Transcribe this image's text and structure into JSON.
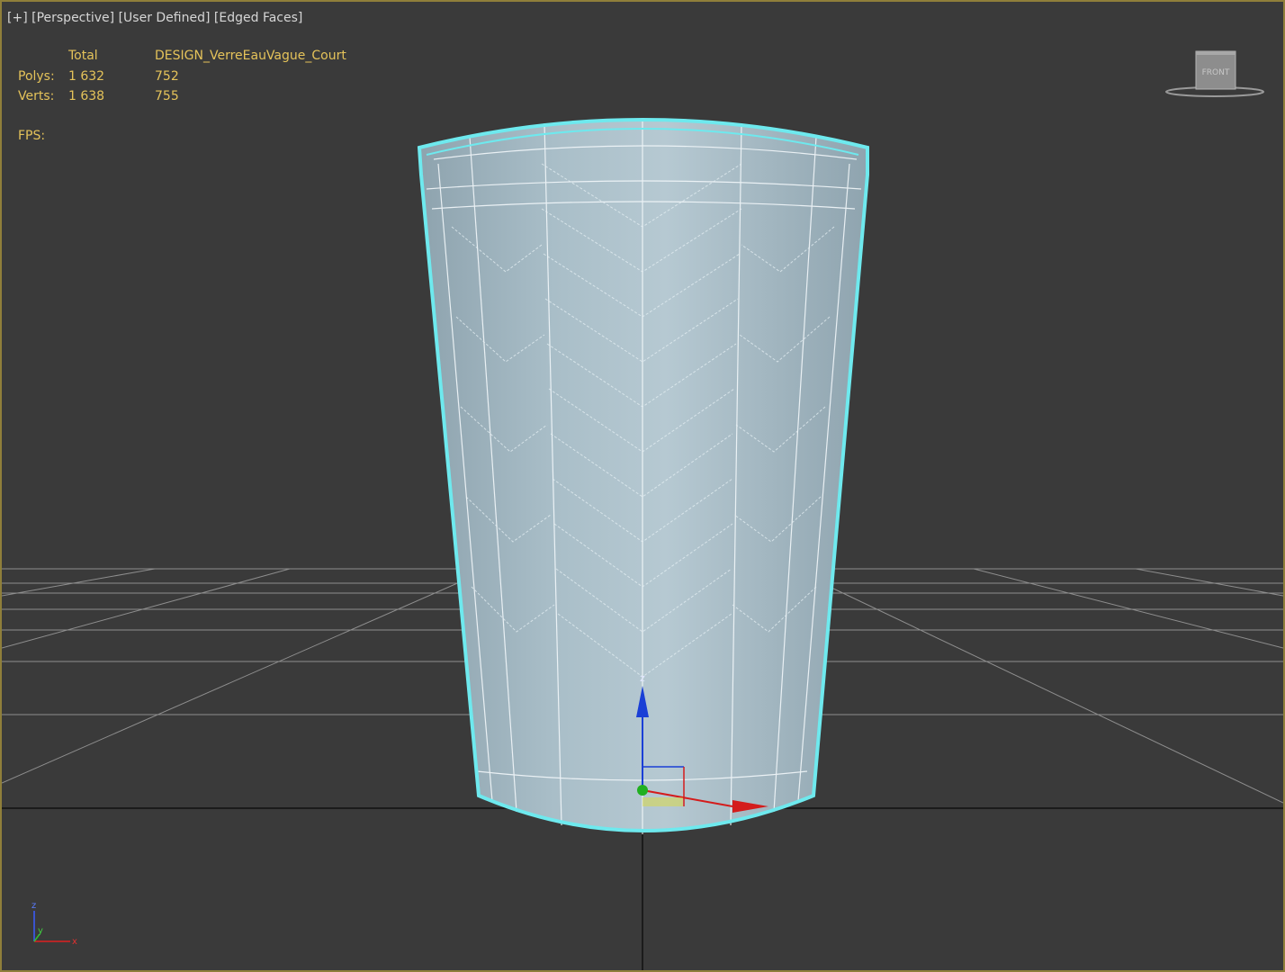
{
  "viewport_labels": {
    "plus": "[+]",
    "view": "[Perspective]",
    "camera": "[User Defined]",
    "shading": "[Edged Faces]"
  },
  "stats": {
    "col_total": "Total",
    "col_object": "DESIGN_VerreEauVague_Court",
    "polys_label": "Polys:",
    "polys_total": "1 632",
    "polys_object": "752",
    "verts_label": "Verts:",
    "verts_total": "1 638",
    "verts_object": "755",
    "fps_label": "FPS:"
  },
  "viewcube": {
    "face_label": "FRONT"
  },
  "gizmo": {
    "z_label": "z",
    "x_label": "x",
    "y_label": "y"
  },
  "colors": {
    "viewport_bg": "#3a3a3a",
    "border": "#8f7f3a",
    "stats": "#e5c35a",
    "selection_outline": "#6ee9ee",
    "glass_fill": "#9fb4bf",
    "axis_x": "#d41c1c",
    "axis_y": "#20b020",
    "axis_z": "#1a3fd6"
  },
  "icons": [
    "viewcube-icon",
    "axis-tripod-icon",
    "transform-gizmo-icon"
  ]
}
